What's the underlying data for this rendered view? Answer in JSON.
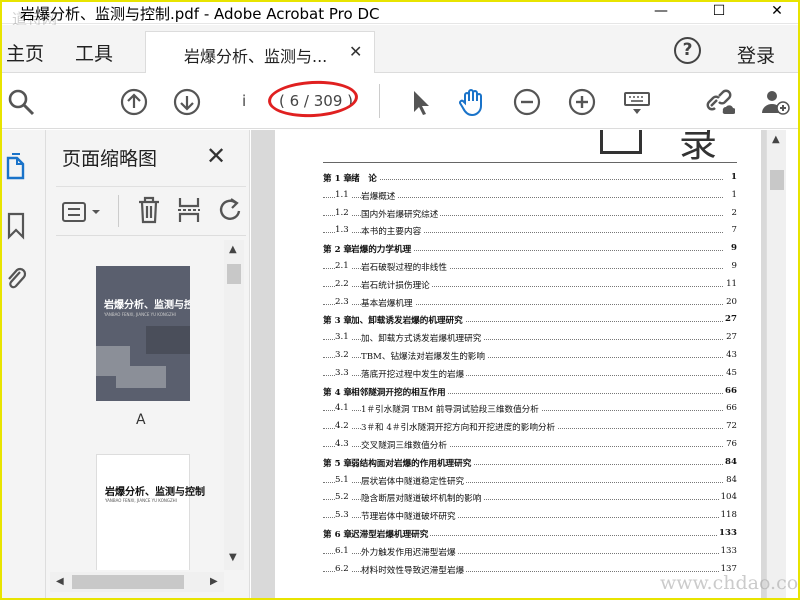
{
  "window": {
    "title": "岩爆分析、监测与控制.pdf - Adobe Acrobat Pro DC",
    "watermark": "道特网",
    "controls": [
      "—",
      "☐",
      "✕"
    ]
  },
  "tabbar": {
    "home": "主页",
    "tools": "工具",
    "doc_tab": "岩爆分析、监测与...",
    "doc_tab_close": "✕",
    "help": "?",
    "login": "登录"
  },
  "toolbar": {
    "page_input": "i",
    "page_count": "( 6 / 309 )",
    "icons": [
      "search-icon",
      "page-up-icon",
      "page-down-icon",
      "select-cursor-icon",
      "hand-tool-icon",
      "zoom-out-icon",
      "zoom-in-icon",
      "keyboard-icon",
      "link-share-icon",
      "add-user-icon"
    ]
  },
  "panel": {
    "title": "页面缩略图",
    "close": "✕",
    "thumbnails": [
      {
        "cover_title": "岩爆分析、监测与控制",
        "cover_subtitle": "YANBAO FENXI, JIANCE YU KONGZHI",
        "label": "A"
      },
      {
        "cover_title": "岩爆分析、监测与控制",
        "cover_subtitle": "YANBAO FENXI, JIANCE YU KONGZHI",
        "label": ""
      }
    ]
  },
  "page": {
    "big_title": "录",
    "toc": [
      {
        "num": "第 1 章",
        "title": "绪　论",
        "page": "1",
        "type": "ch"
      },
      {
        "num": "1.1",
        "title": "岩爆概述",
        "page": "1",
        "type": "sec"
      },
      {
        "num": "1.2",
        "title": "国内外岩爆研究综述",
        "page": "2",
        "type": "sec"
      },
      {
        "num": "1.3",
        "title": "本书的主要内容",
        "page": "7",
        "type": "sec"
      },
      {
        "num": "第 2 章",
        "title": "岩爆的力学机理",
        "page": "9",
        "type": "ch"
      },
      {
        "num": "2.1",
        "title": "岩石破裂过程的非线性",
        "page": "9",
        "type": "sec"
      },
      {
        "num": "2.2",
        "title": "岩石统计损伤理论",
        "page": "11",
        "type": "sec"
      },
      {
        "num": "2.3",
        "title": "基本岩爆机理",
        "page": "20",
        "type": "sec"
      },
      {
        "num": "第 3 章",
        "title": "加、卸载诱发岩爆的机理研究",
        "page": "27",
        "type": "ch"
      },
      {
        "num": "3.1",
        "title": "加、卸载方式诱发岩爆机理研究",
        "page": "27",
        "type": "sec"
      },
      {
        "num": "3.2",
        "title": "TBM、钻爆法对岩爆发生的影响",
        "page": "43",
        "type": "sec"
      },
      {
        "num": "3.3",
        "title": "落底开挖过程中发生的岩爆",
        "page": "45",
        "type": "sec"
      },
      {
        "num": "第 4 章",
        "title": "相邻隧洞开挖的相互作用",
        "page": "66",
        "type": "ch"
      },
      {
        "num": "4.1",
        "title": "1＃引水隧洞 TBM 前导洞试验段三维数值分析",
        "page": "66",
        "type": "sec"
      },
      {
        "num": "4.2",
        "title": "3＃和 4＃引水隧洞开挖方向和开挖进度的影响分析",
        "page": "72",
        "type": "sec"
      },
      {
        "num": "4.3",
        "title": "交叉隧洞三维数值分析",
        "page": "76",
        "type": "sec"
      },
      {
        "num": "第 5 章",
        "title": "弱结构面对岩爆的作用机理研究",
        "page": "84",
        "type": "ch"
      },
      {
        "num": "5.1",
        "title": "层状岩体中隧道稳定性研究",
        "page": "84",
        "type": "sec"
      },
      {
        "num": "5.2",
        "title": "隐含断层对隧道破坏机制的影响",
        "page": "104",
        "type": "sec"
      },
      {
        "num": "5.3",
        "title": "节理岩体中隧道破坏研究",
        "page": "118",
        "type": "sec"
      },
      {
        "num": "第 6 章",
        "title": "迟滞型岩爆机理研究",
        "page": "133",
        "type": "ch"
      },
      {
        "num": "6.1",
        "title": "外力触发作用迟滞型岩爆",
        "page": "133",
        "type": "sec"
      },
      {
        "num": "6.2",
        "title": "材料时效性导致迟滞型岩爆",
        "page": "137",
        "type": "sec"
      }
    ]
  },
  "bottom_watermark": "www.chdao.com"
}
